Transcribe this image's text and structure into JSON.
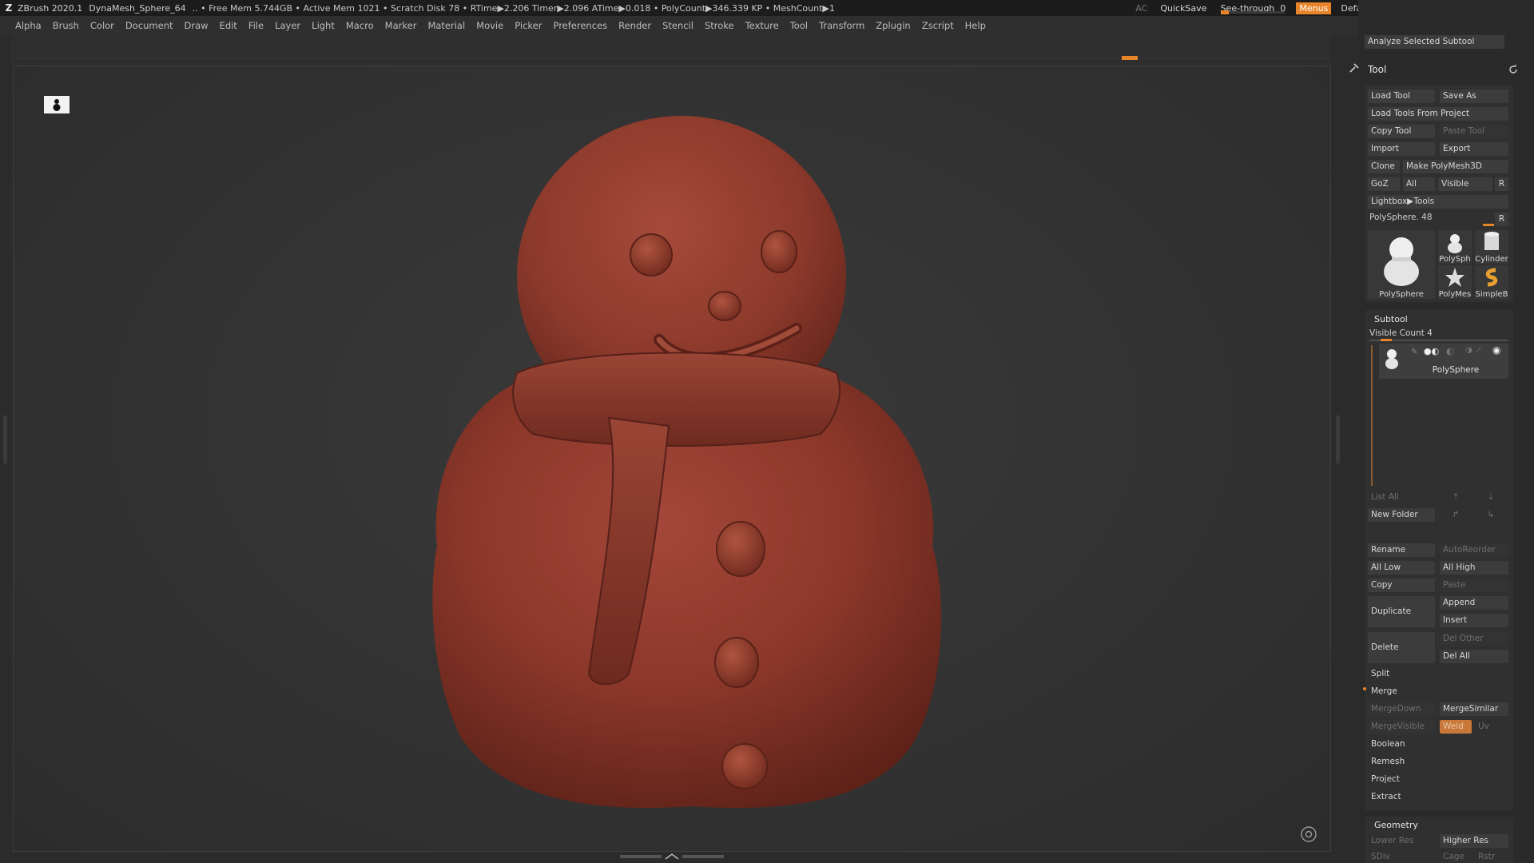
{
  "titlebar": {
    "app": "ZBrush 2020.1",
    "document": "DynaMesh_Sphere_64",
    "status": "..  • Free Mem 5.744GB • Active Mem 1021 • Scratch Disk 78 •  RTime▶2.206 Timer▶2.096 ATime▶0.018 • PolyCount▶346.339 KP  • MeshCount▶1",
    "ac": "AC",
    "quicksave": "QuickSave",
    "see_through_label": "See-through",
    "see_through_value": "0",
    "see_through_level": 0,
    "menus": "Menus",
    "script": "DefaultZScript"
  },
  "menubar": [
    "Alpha",
    "Brush",
    "Color",
    "Document",
    "Draw",
    "Edit",
    "File",
    "Layer",
    "Light",
    "Macro",
    "Marker",
    "Material",
    "Movie",
    "Picker",
    "Preferences",
    "Render",
    "Stencil",
    "Stroke",
    "Texture",
    "Tool",
    "Transform",
    "Zplugin",
    "Zscript",
    "Help"
  ],
  "rightpanel": {
    "analyze": "Analyze Selected Subtool",
    "tool_title": "Tool",
    "load_tool": "Load Tool",
    "save_as": "Save As",
    "load_from_project": "Load Tools From Project",
    "copy_tool": "Copy Tool",
    "paste_tool": "Paste Tool",
    "import": "Import",
    "export": "Export",
    "clone": "Clone",
    "make_polymesh": "Make PolyMesh3D",
    "goz": "GoZ",
    "all": "All",
    "visible": "Visible",
    "r": "R",
    "lightbox_tools": "Lightbox▶Tools",
    "current_tool": "PolySphere. 48",
    "thumbs": [
      "PolySphere",
      "PolySph",
      "Cylinder",
      "PolyMes",
      "SimpleB"
    ],
    "subtool_title": "Subtool",
    "visible_count": "Visible Count 4",
    "subtool_item": "PolySphere",
    "list_all": "List All",
    "new_folder": "New Folder",
    "rename": "Rename",
    "auto_reorder": "AutoReorder",
    "all_low": "All Low",
    "all_high": "All High",
    "copy": "Copy",
    "paste": "Paste",
    "duplicate": "Duplicate",
    "append": "Append",
    "insert": "Insert",
    "delete": "Delete",
    "del_other": "Del Other",
    "del_all": "Del All",
    "split": "Split",
    "merge": "Merge",
    "merge_down": "MergeDown",
    "merge_similar": "MergeSimilar",
    "merge_visible": "MergeVisible",
    "weld": "Weld",
    "uv": "Uv",
    "boolean": "Boolean",
    "remesh": "Remesh",
    "project": "Project",
    "extract": "Extract",
    "geometry_title": "Geometry",
    "lower_res": "Lower Res",
    "higher_res": "Higher Res",
    "sdiv": "SDiv",
    "cage": "Cage",
    "rstr": "Rstr"
  },
  "colors": {
    "accent": "#e8842a",
    "clay": "#8e3a2c"
  }
}
